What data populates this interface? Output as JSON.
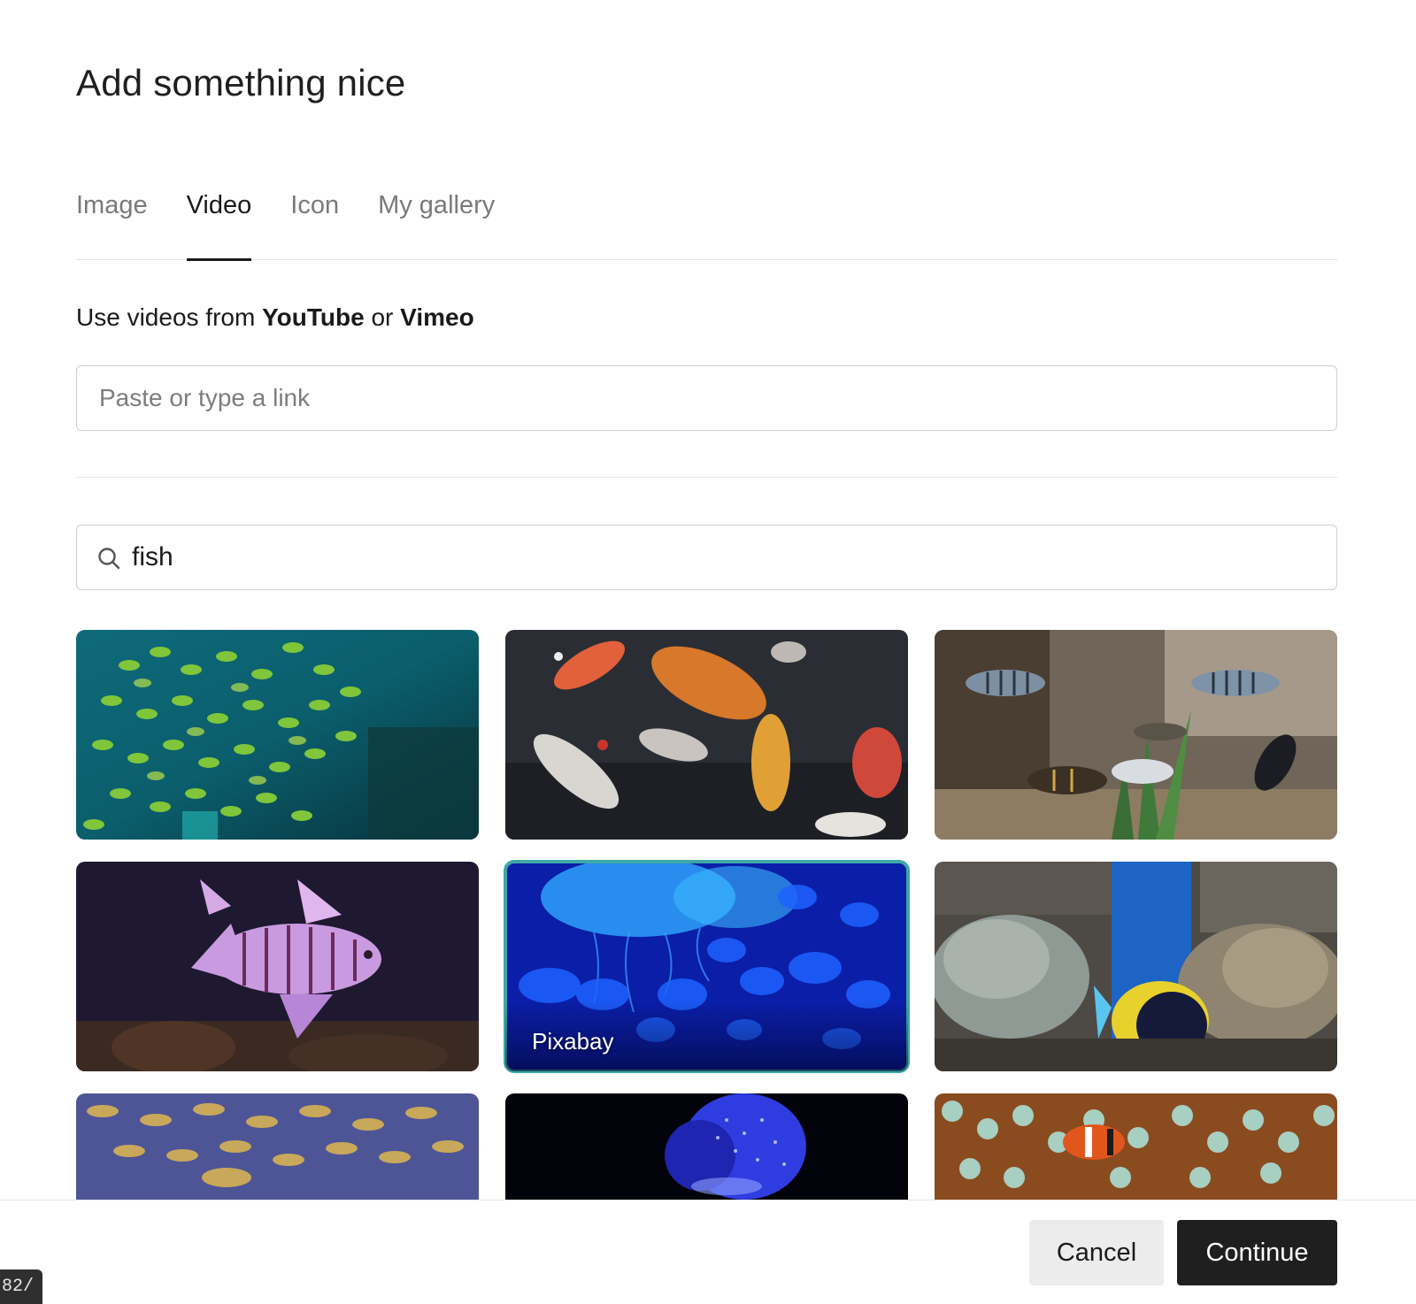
{
  "dialog": {
    "title": "Add something nice"
  },
  "tabs": [
    {
      "label": "Image",
      "active": false
    },
    {
      "label": "Video",
      "active": true
    },
    {
      "label": "Icon",
      "active": false
    },
    {
      "label": "My gallery",
      "active": false
    }
  ],
  "video": {
    "hint_prefix": "Use videos from ",
    "hint_source1": "YouTube",
    "hint_mid": " or ",
    "hint_source2": "Vimeo",
    "link_placeholder": "Paste or type a link",
    "link_value": ""
  },
  "search": {
    "value": "fish",
    "icon": "search-icon"
  },
  "results": [
    {
      "subject": "school of green fish",
      "label": ""
    },
    {
      "subject": "koi fish",
      "label": ""
    },
    {
      "subject": "aquarium cichlids",
      "label": ""
    },
    {
      "subject": "lionfish",
      "label": ""
    },
    {
      "subject": "blue jellyfish",
      "label": "Pixabay",
      "selected": true
    },
    {
      "subject": "coral reef tang",
      "label": ""
    },
    {
      "subject": "school of striped fish",
      "label": ""
    },
    {
      "subject": "glowing jellyfish",
      "label": ""
    },
    {
      "subject": "clownfish anemone",
      "label": ""
    }
  ],
  "footer": {
    "cancel_label": "Cancel",
    "continue_label": "Continue"
  },
  "status_url_fragment": "82/",
  "colors": {
    "accent_selected": "#3ea8a6",
    "primary_button": "#1f1f1f",
    "secondary_button": "#ececec"
  }
}
